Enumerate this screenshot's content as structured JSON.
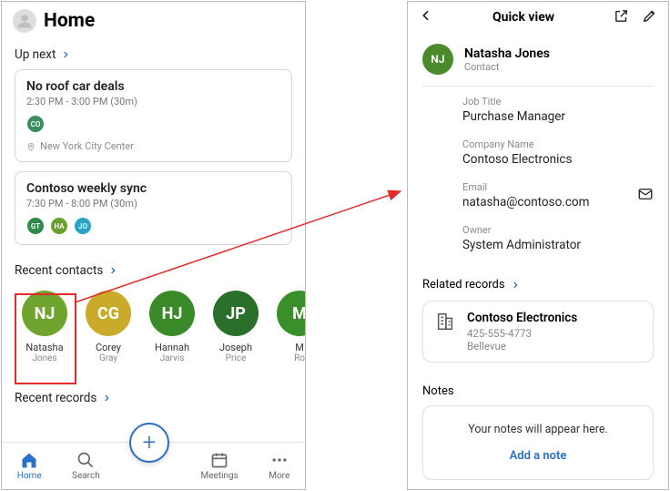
{
  "home": {
    "title": "Home",
    "up_next_label": "Up next",
    "recent_contacts_label": "Recent contacts",
    "recent_records_label": "Recent records",
    "events": [
      {
        "title": "No roof car deals",
        "time": "2:30 PM - 3:00 PM (30m)",
        "location": "New York City Center",
        "attendees": [
          {
            "initials": "CO",
            "color": "#3a8f5f"
          }
        ]
      },
      {
        "title": "Contoso weekly sync",
        "time": "7:30 PM - 8:00 PM (30m)",
        "attendees": [
          {
            "initials": "GT",
            "color": "#2f8a4e"
          },
          {
            "initials": "HA",
            "color": "#3f8f2a"
          },
          {
            "initials": "JO",
            "color": "#2aa3c9"
          }
        ]
      }
    ],
    "contacts": [
      {
        "initials": "NJ",
        "first": "Natasha",
        "last": "Jones",
        "color": "#6fa52e"
      },
      {
        "initials": "CG",
        "first": "Corey",
        "last": "Gray",
        "color": "#c9aa2a"
      },
      {
        "initials": "HJ",
        "first": "Hannah",
        "last": "Jarvis",
        "color": "#3a8a2a"
      },
      {
        "initials": "JP",
        "first": "Joseph",
        "last": "Price",
        "color": "#2a6f2a"
      },
      {
        "initials": "M",
        "first": "M",
        "last": "Ro",
        "color": "#3a8f2a"
      }
    ],
    "tabs": {
      "home": "Home",
      "search": "Search",
      "meetings": "Meetings",
      "more": "More"
    }
  },
  "quick": {
    "title": "Quick view",
    "contact": {
      "initials": "NJ",
      "name": "Natasha Jones",
      "type": "Contact",
      "job_title_label": "Job Title",
      "job_title": "Purchase Manager",
      "company_label": "Company Name",
      "company": "Contoso Electronics",
      "email_label": "Email",
      "email": "natasha@contoso.com",
      "owner_label": "Owner",
      "owner": "System Administrator"
    },
    "related_label": "Related records",
    "related": {
      "name": "Contoso Electronics",
      "phone": "425-555-4773",
      "city": "Bellevue"
    },
    "notes_label": "Notes",
    "notes_empty": "Your notes will appear here.",
    "add_note": "Add a note"
  }
}
